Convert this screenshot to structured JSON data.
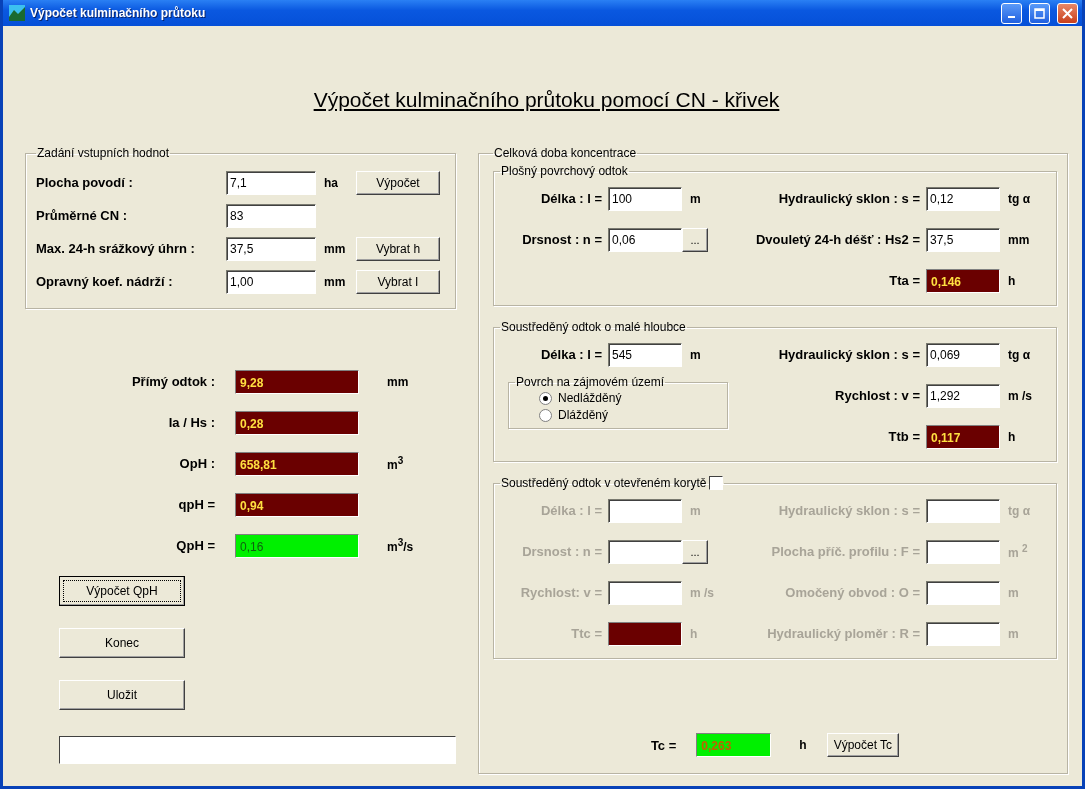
{
  "window": {
    "title": "Výpočet kulminačního průtoku"
  },
  "heading": "Výpočet kulminačního průtoku pomocí CN - křivek",
  "inputs": {
    "title": "Zadání vstupních hodnot",
    "rows": [
      {
        "label": "Plocha povodí :",
        "value": "7,1",
        "unit": "ha",
        "button": "Výpočet"
      },
      {
        "label": "Průměrné CN :",
        "value": "83"
      },
      {
        "label": "Max. 24-h srážkový úhrn :",
        "value": "37,5",
        "unit": "mm",
        "button": "Vybrat h"
      },
      {
        "label": "Opravný koef. nádrží :",
        "value": "1,00",
        "unit": "mm",
        "button": "Vybrat I"
      }
    ]
  },
  "results": [
    {
      "label": "Přímý odtok :",
      "value": "9,28",
      "unit": "mm",
      "kind": "dark"
    },
    {
      "label": "Ia / Hs :",
      "value": "0,28",
      "kind": "dark"
    },
    {
      "label": "OpH :",
      "value": "658,81",
      "unit": "m$^{3}$",
      "kind": "dark"
    },
    {
      "label": "qpH =",
      "value": "0,94",
      "kind": "dark"
    },
    {
      "label": "QpH =",
      "value": "0,16",
      "unit": "m$^{3}$/s",
      "kind": "green"
    }
  ],
  "buttons": [
    {
      "label": "Výpočet QpH",
      "focused": true
    },
    {
      "label": "Konec",
      "focused": false
    },
    {
      "label": "Uložit",
      "focused": false
    }
  ],
  "concentration": {
    "title": "Celková doba koncentrace",
    "sections": [
      {
        "title": "Plošný povrchový odtok",
        "disabled": false,
        "rows": [
          {
            "left": {
              "label": "Délka : l =",
              "value": "100",
              "unit": "m",
              "kind": "input"
            },
            "right": {
              "label": "Hydraulický sklon : s =",
              "value": "0,12",
              "unit": "tg α",
              "kind": "input"
            }
          },
          {
            "left": {
              "label": "Drsnost : n =",
              "value": "0,06",
              "button": "...",
              "kind": "browse"
            },
            "right": {
              "label": "Dvouletý 24-h déšť : Hs2 =",
              "value": "37,5",
              "unit": "mm",
              "kind": "input"
            }
          },
          {
            "right": {
              "label": "Tta =",
              "value": "0,146",
              "unit": "h",
              "kind": "dark"
            }
          }
        ]
      },
      {
        "title": "Soustředěný odtok o malé hloubce",
        "disabled": false,
        "rows": [
          {
            "left": {
              "label": "Délka : l =",
              "value": "545",
              "unit": "m",
              "kind": "input"
            },
            "right": {
              "label": "Hydraulický sklon : s =",
              "value": "0,069",
              "unit": "tg α",
              "kind": "input"
            }
          },
          {
            "right": {
              "label": "Rychlost : v =",
              "value": "1,292",
              "unit": "m /s",
              "kind": "input"
            }
          },
          {
            "right": {
              "label": "Ttb =",
              "value": "0,117",
              "unit": "h",
              "kind": "dark"
            }
          }
        ],
        "radio_group": {
          "title": "Povrch na zájmovém území",
          "options": [
            {
              "label": "Nedlážděný",
              "selected": true
            },
            {
              "label": "Dlážděný",
              "selected": false
            }
          ]
        }
      },
      {
        "title": "Soustředěný odtok v otevřeném korytě",
        "disabled": true,
        "checkbox": {
          "checked": false
        },
        "rows": [
          {
            "left": {
              "label": "Délka : l =",
              "unit": "m",
              "kind": "input"
            },
            "right": {
              "label": "Hydraulický sklon : s =",
              "unit": "tg α",
              "kind": "input"
            }
          },
          {
            "left": {
              "label": "Drsnost : n =",
              "button": "...",
              "kind": "browse"
            },
            "right": {
              "label": "Plocha příč. profilu : F =",
              "unit": "m $^{2}$",
              "kind": "input"
            }
          },
          {
            "left": {
              "label": "Rychlost: v =",
              "unit": "m /s",
              "kind": "input"
            },
            "right": {
              "label": "Omočený obvod : O =",
              "unit": "m",
              "kind": "input"
            }
          },
          {
            "left": {
              "label": "Ttc =",
              "unit": "h",
              "kind": "dark"
            },
            "right": {
              "label": "Hydraulický ploměr : R =",
              "unit": "m",
              "kind": "input"
            }
          }
        ]
      }
    ],
    "total": {
      "label": "Tc =",
      "value": "0,263",
      "unit": "h",
      "kind": "green",
      "button": "Výpočet Tc"
    }
  }
}
